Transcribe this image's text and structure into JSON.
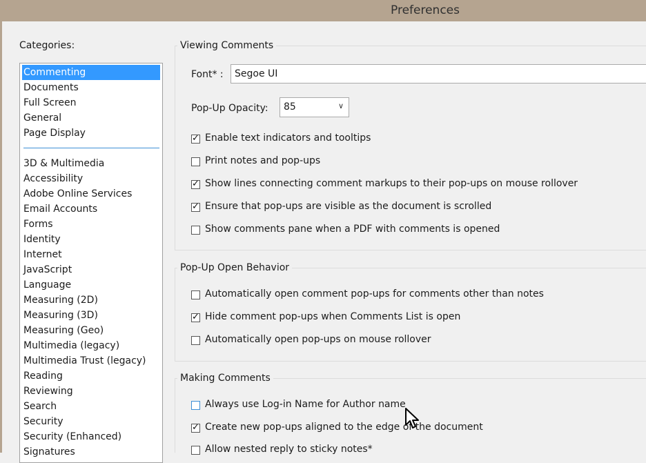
{
  "window": {
    "title": "Preferences"
  },
  "categories": {
    "label": "Categories:",
    "items": [
      {
        "label": "Commenting",
        "selected": true
      },
      {
        "label": "Documents"
      },
      {
        "label": "Full Screen"
      },
      {
        "label": "General"
      },
      {
        "label": "Page Display"
      },
      {
        "label": "3D & Multimedia"
      },
      {
        "label": "Accessibility"
      },
      {
        "label": "Adobe Online Services"
      },
      {
        "label": "Email Accounts"
      },
      {
        "label": "Forms"
      },
      {
        "label": "Identity"
      },
      {
        "label": "Internet"
      },
      {
        "label": "JavaScript"
      },
      {
        "label": "Language"
      },
      {
        "label": "Measuring (2D)"
      },
      {
        "label": "Measuring (3D)"
      },
      {
        "label": "Measuring (Geo)"
      },
      {
        "label": "Multimedia (legacy)"
      },
      {
        "label": "Multimedia Trust (legacy)"
      },
      {
        "label": "Reading"
      },
      {
        "label": "Reviewing"
      },
      {
        "label": "Search"
      },
      {
        "label": "Security"
      },
      {
        "label": "Security (Enhanced)"
      },
      {
        "label": "Signatures"
      }
    ]
  },
  "viewing": {
    "title": "Viewing Comments",
    "font_label": "Font* :",
    "font_value": "Segoe UI",
    "opacity_label": "Pop-Up Opacity:",
    "opacity_value": "85",
    "options": [
      {
        "label": "Enable text indicators and tooltips",
        "checked": true
      },
      {
        "label": "Print notes and pop-ups",
        "checked": false
      },
      {
        "label": "Show lines connecting comment markups to their pop-ups on mouse rollover",
        "checked": true
      },
      {
        "label": "Ensure that pop-ups are visible as the document is scrolled",
        "checked": true
      },
      {
        "label": "Show comments pane when a PDF with comments is opened",
        "checked": false
      }
    ]
  },
  "popup_behavior": {
    "title": "Pop-Up Open Behavior",
    "options": [
      {
        "label": "Automatically open comment pop-ups for comments other than notes",
        "checked": false
      },
      {
        "label": "Hide comment pop-ups when Comments List is open",
        "checked": true
      },
      {
        "label": "Automatically open pop-ups on mouse rollover",
        "checked": false
      }
    ]
  },
  "making": {
    "title": "Making Comments",
    "options": [
      {
        "label": "Always use Log-in Name for Author name",
        "checked": false
      },
      {
        "label": "Create new pop-ups aligned to the edge of the document",
        "checked": true
      },
      {
        "label": "Allow nested reply to sticky notes*",
        "checked": false
      }
    ]
  },
  "icons": {
    "check": "checkmark-icon",
    "dropdown": "chevron-down-icon",
    "cursor": "mouse-pointer-icon"
  },
  "colors": {
    "selection": "#3399ff",
    "titlebar": "#b5a490",
    "separator": "#3c8fd6"
  }
}
